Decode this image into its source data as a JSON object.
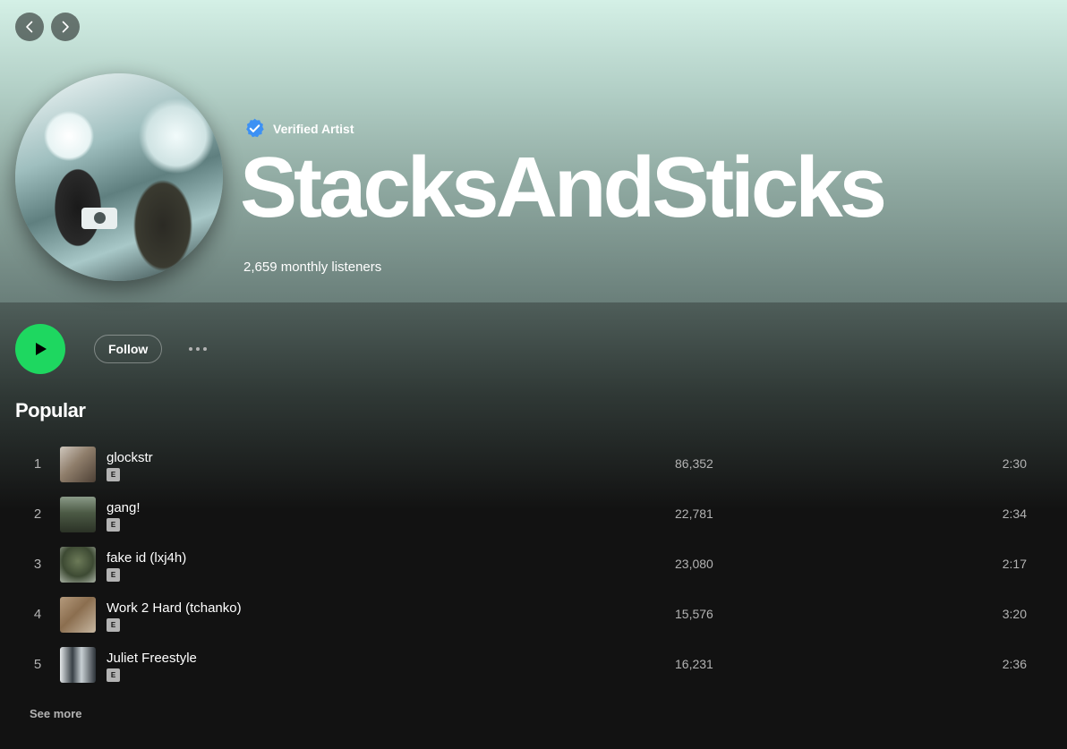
{
  "artist": {
    "verified_label": "Verified Artist",
    "name": "StacksAndSticks",
    "monthly_listeners": "2,659 monthly listeners"
  },
  "actions": {
    "follow_label": "Follow"
  },
  "popular": {
    "title": "Popular",
    "tracks": [
      {
        "rank": "1",
        "title": "glockstr",
        "explicit": "E",
        "plays": "86,352",
        "duration": "2:30"
      },
      {
        "rank": "2",
        "title": "gang!",
        "explicit": "E",
        "plays": "22,781",
        "duration": "2:34"
      },
      {
        "rank": "3",
        "title": "fake id (lxj4h)",
        "explicit": "E",
        "plays": "23,080",
        "duration": "2:17"
      },
      {
        "rank": "4",
        "title": "Work 2 Hard (tchanko)",
        "explicit": "E",
        "plays": "15,576",
        "duration": "3:20"
      },
      {
        "rank": "5",
        "title": "Juliet Freestyle",
        "explicit": "E",
        "plays": "16,231",
        "duration": "2:36"
      }
    ],
    "see_more_label": "See more"
  },
  "colors": {
    "accent": "#1ed760",
    "background": "#121212",
    "verified_badge": "#3d91f4",
    "secondary_text": "#b3b3b3"
  },
  "icons": {
    "back": "chevron-left-icon",
    "forward": "chevron-right-icon",
    "verified": "verified-badge-icon",
    "play": "play-icon",
    "more": "more-options-icon"
  }
}
